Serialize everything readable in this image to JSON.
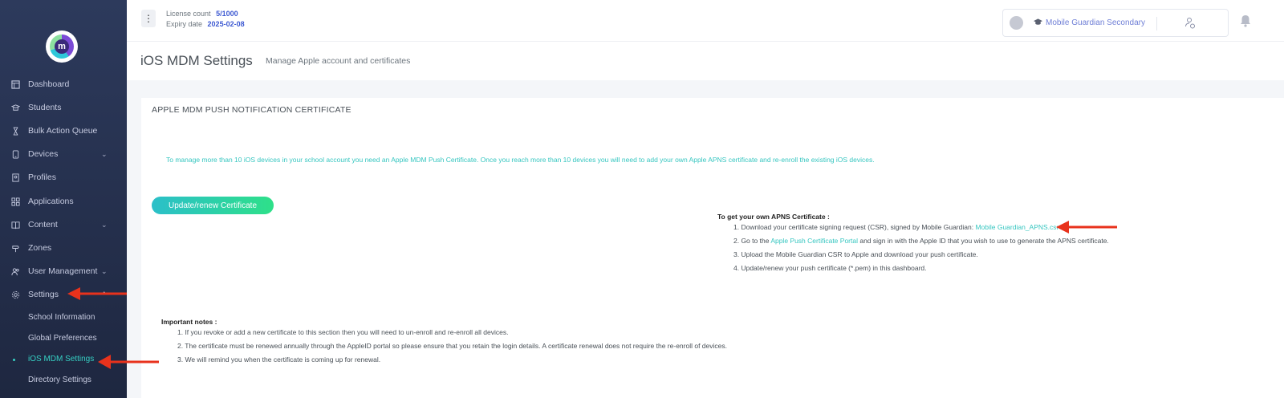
{
  "sidebar": {
    "logo_letter": "m",
    "items": [
      {
        "label": "Dashboard",
        "icon": "dashboard-icon"
      },
      {
        "label": "Students",
        "icon": "students-icon"
      },
      {
        "label": "Bulk Action Queue",
        "icon": "hourglass-icon"
      },
      {
        "label": "Devices",
        "icon": "device-icon",
        "chevron": "⌄"
      },
      {
        "label": "Profiles",
        "icon": "profiles-icon"
      },
      {
        "label": "Applications",
        "icon": "grid-icon"
      },
      {
        "label": "Content",
        "icon": "content-icon",
        "chevron": "⌄"
      },
      {
        "label": "Zones",
        "icon": "zones-icon"
      },
      {
        "label": "User Management",
        "icon": "users-icon",
        "chevron": "⌄"
      },
      {
        "label": "Settings",
        "icon": "gear-icon",
        "chevron": "⌃"
      }
    ],
    "sub_items": [
      {
        "label": "School Information"
      },
      {
        "label": "Global Preferences"
      },
      {
        "label": "iOS MDM Settings",
        "active": true
      },
      {
        "label": "Directory Settings"
      }
    ]
  },
  "header": {
    "kebab": "⋮",
    "license_count_label": "License count",
    "license_count_value": "5/1000",
    "expiry_label": "Expiry date",
    "expiry_value": "2025-02-08",
    "school_name": "Mobile Guardian Secondary"
  },
  "page": {
    "title": "iOS MDM Settings",
    "subtitle": "Manage Apple account and certificates"
  },
  "card": {
    "title": "APPLE MDM PUSH NOTIFICATION CERTIFICATE",
    "intro": "To manage more than 10 iOS devices in your school account you need an Apple MDM Push Certificate. Once you reach more than 10 devices you will need to add your own Apple APNS certificate and re-enroll the existing iOS devices.",
    "update_button": "Update/renew Certificate",
    "apns_heading": "To get your own APNS Certificate :",
    "apns_steps": {
      "s1_prefix": "1. Download your certificate signing request (CSR), signed by Mobile Guardian: ",
      "s1_link": "Mobile Guardian_APNS.csr",
      "s2_prefix": "2. Go to the ",
      "s2_link": "Apple Push Certificate Portal",
      "s2_suffix": " and sign in with the Apple ID that you wish to use to generate the APNS certificate.",
      "s3": "3. Upload the Mobile Guardian CSR to Apple and download your push certificate.",
      "s4": "4. Update/renew your push certificate (*.pem) in this dashboard."
    },
    "notes_heading": "Important notes :",
    "notes": [
      "1. If you revoke or add a new certificate to this section then you will need to un-enroll and re-enroll all devices.",
      "2. The certificate must be renewed annually through the AppleID portal so please ensure that you retain the login details. A certificate renewal does not require the re-enroll of devices.",
      "3. We will remind you when the certificate is coming up for renewal."
    ]
  },
  "colors": {
    "sidebar_bg": "#2d3a5c",
    "accent_teal": "#36c6c0",
    "link_blue": "#3e5ad2",
    "annotation_arrow": "#e8321c"
  }
}
